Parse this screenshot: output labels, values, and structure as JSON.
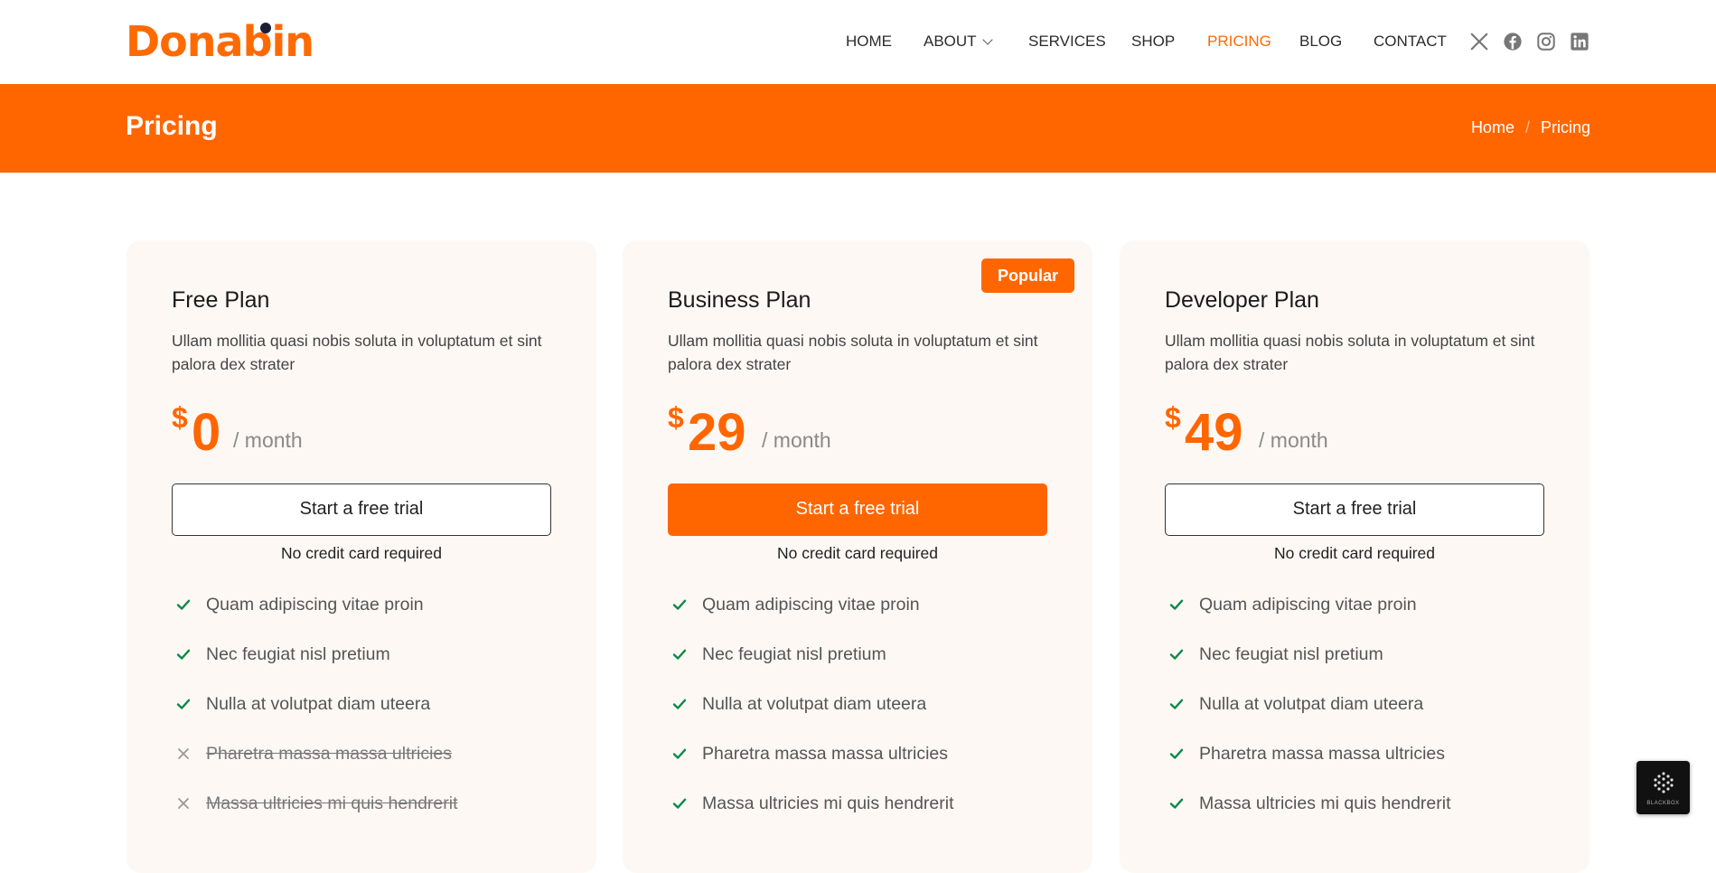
{
  "header": {
    "logo": "Donabin",
    "nav": [
      "HOME",
      "ABOUT",
      "SERVICES",
      "SHOP",
      "PRICING",
      "BLOG",
      "CONTACT"
    ],
    "active_nav": "PRICING",
    "social_icons": [
      "x-icon",
      "facebook-icon",
      "instagram-icon",
      "linkedin-icon"
    ]
  },
  "banner": {
    "title": "Pricing",
    "breadcrumb": [
      "Home",
      "Pricing"
    ],
    "separator": "/"
  },
  "plans": [
    {
      "name": "Free Plan",
      "description": "Ullam mollitia quasi nobis soluta in voluptatum et sint palora dex strater",
      "currency": "$",
      "price": "0",
      "period": "/ month",
      "cta": "Start a free trial",
      "note": "No credit card required",
      "features": [
        {
          "text": "Quam adipiscing vitae proin",
          "included": true
        },
        {
          "text": "Nec feugiat nisl pretium",
          "included": true
        },
        {
          "text": "Nulla at volutpat diam uteera",
          "included": true
        },
        {
          "text": "Pharetra massa massa ultricies",
          "included": false
        },
        {
          "text": "Massa ultricies mi quis hendrerit",
          "included": false
        }
      ]
    },
    {
      "name": "Business Plan",
      "badge": "Popular",
      "description": "Ullam mollitia quasi nobis soluta in voluptatum et sint palora dex strater",
      "currency": "$",
      "price": "29",
      "period": "/ month",
      "cta": "Start a free trial",
      "note": "No credit card required",
      "features": [
        {
          "text": "Quam adipiscing vitae proin",
          "included": true
        },
        {
          "text": "Nec feugiat nisl pretium",
          "included": true
        },
        {
          "text": "Nulla at volutpat diam uteera",
          "included": true
        },
        {
          "text": "Pharetra massa massa ultricies",
          "included": true
        },
        {
          "text": "Massa ultricies mi quis hendrerit",
          "included": true
        }
      ]
    },
    {
      "name": "Developer Plan",
      "description": "Ullam mollitia quasi nobis soluta in voluptatum et sint palora dex strater",
      "currency": "$",
      "price": "49",
      "period": "/ month",
      "cta": "Start a free trial",
      "note": "No credit card required",
      "features": [
        {
          "text": "Quam adipiscing vitae proin",
          "included": true
        },
        {
          "text": "Nec feugiat nisl pretium",
          "included": true
        },
        {
          "text": "Nulla at volutpat diam uteera",
          "included": true
        },
        {
          "text": "Pharetra massa massa ultricies",
          "included": true
        },
        {
          "text": "Massa ultricies mi quis hendrerit",
          "included": true
        }
      ]
    }
  ],
  "widget": {
    "label": "BLACKBOX"
  },
  "colors": {
    "accent": "#ff6600",
    "check": "#0a8a4a",
    "cross": "#999999",
    "card_bg": "#fdf8f4"
  }
}
